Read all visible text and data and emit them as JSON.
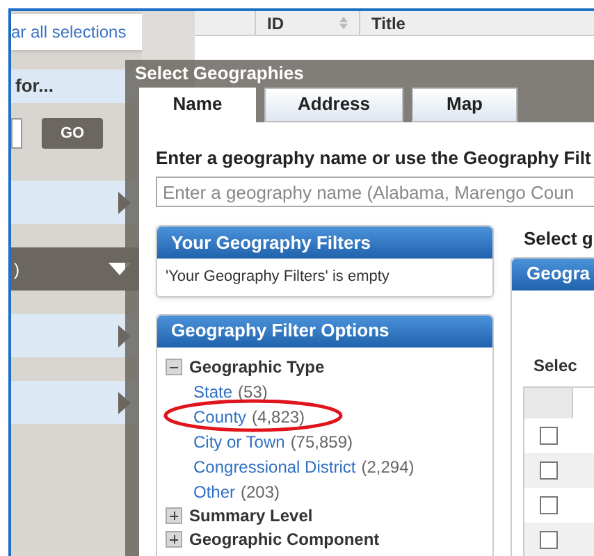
{
  "background": {
    "sidebar": {
      "link": "ar all selections",
      "search_heading": "for...",
      "go_button": "GO",
      "items": [
        {
          "expanded": false
        },
        {
          "label": ")",
          "expanded": true
        },
        {
          "expanded": false
        },
        {
          "expanded": false
        }
      ]
    },
    "table": {
      "columns": [
        "ID",
        "Title"
      ]
    }
  },
  "dialog": {
    "title": "Select Geographies",
    "tabs": [
      {
        "label": "Name",
        "selected": true
      },
      {
        "label": "Address",
        "selected": false
      },
      {
        "label": "Map",
        "selected": false
      }
    ],
    "prompt": "Enter a geography name or use the Geography Filt",
    "search": {
      "placeholder": "Enter a geography name (Alabama, Marengo Coun"
    },
    "your_filters": {
      "title": "Your Geography Filters",
      "message": "'Your Geography Filters' is empty"
    },
    "filter_options": {
      "title": "Geography Filter Options",
      "tree": [
        {
          "label": "Geographic Type",
          "expanded": true,
          "children": [
            {
              "name": "State",
              "count": "(53)"
            },
            {
              "name": "County",
              "count": "(4,823)"
            },
            {
              "name": "City or Town",
              "count": "(75,859)"
            },
            {
              "name": "Congressional District",
              "count": "(2,294)"
            },
            {
              "name": "Other",
              "count": "(203)"
            }
          ]
        },
        {
          "label": "Summary Level",
          "expanded": false
        },
        {
          "label": "Geographic Component",
          "expanded": false
        }
      ]
    },
    "results": {
      "heading": "Select g",
      "panel_title": "Geogra",
      "select_label": "Selec",
      "rows": [
        {
          "checked": false
        },
        {
          "checked": false
        },
        {
          "checked": false
        },
        {
          "checked": false
        }
      ]
    }
  }
}
